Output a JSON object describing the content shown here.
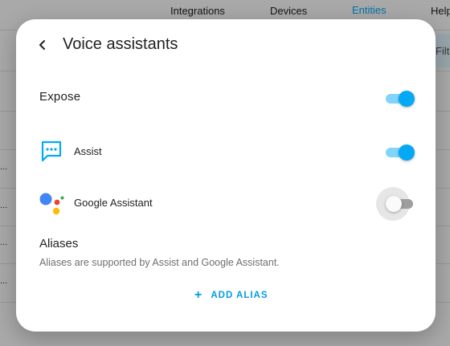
{
  "background": {
    "tabs": [
      "Integrations",
      "Devices",
      "Entities",
      "Help"
    ],
    "active_tab": "Entities",
    "filter_label": "Filte",
    "row_marker": "..."
  },
  "dialog": {
    "title": "Voice assistants",
    "expose": {
      "label": "Expose",
      "enabled": true
    },
    "assistants": [
      {
        "name": "Assist",
        "icon": "assist-chat-icon",
        "enabled": true
      },
      {
        "name": "Google Assistant",
        "icon": "google-assistant-icon",
        "enabled": false
      }
    ],
    "aliases": {
      "title": "Aliases",
      "description": "Aliases are supported by Assist and Google Assistant.",
      "add_label": "ADD ALIAS"
    }
  },
  "colors": {
    "accent": "#03a9f4",
    "accent_track": "#81d4fa",
    "text_primary": "#212121",
    "text_secondary": "#6f6f6f"
  }
}
